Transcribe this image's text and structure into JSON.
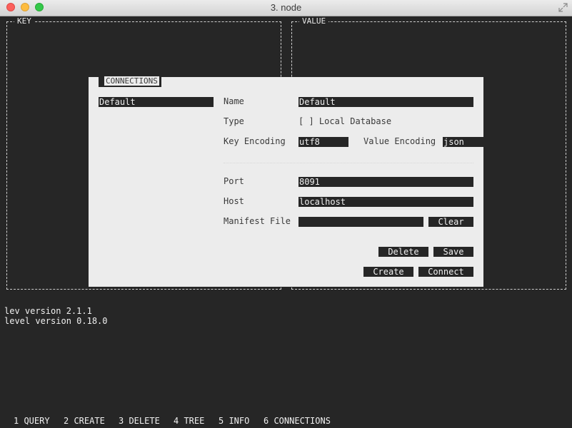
{
  "window": {
    "title": "3. node"
  },
  "panels": {
    "key_label": "KEY",
    "value_label": "VALUE"
  },
  "modal": {
    "tab_label": "CONNECTIONS",
    "connections": [
      "Default"
    ],
    "fields": {
      "name_label": "Name",
      "name_value": "Default",
      "type_label": "Type",
      "type_value": "[ ] Local Database",
      "key_encoding_label": "Key Encoding",
      "key_encoding_value": "utf8",
      "value_encoding_label": "Value Encoding",
      "value_encoding_value": "json",
      "port_label": "Port",
      "port_value": "8091",
      "host_label": "Host",
      "host_value": "localhost",
      "manifest_label": "Manifest File",
      "manifest_value": ""
    },
    "buttons": {
      "clear": "Clear",
      "delete": "Delete",
      "save": "Save",
      "create": "Create",
      "connect": "Connect"
    }
  },
  "console": {
    "lines": [
      "lev version 2.1.1",
      "level version 0.18.0"
    ]
  },
  "bottom_nav": {
    "items": [
      "1 QUERY",
      "2 CREATE",
      "3 DELETE",
      "4 TREE",
      "5 INFO",
      "6 CONNECTIONS"
    ]
  },
  "colors": {
    "background": "#262626",
    "modal_background": "#ececec",
    "field_background": "#262626"
  }
}
